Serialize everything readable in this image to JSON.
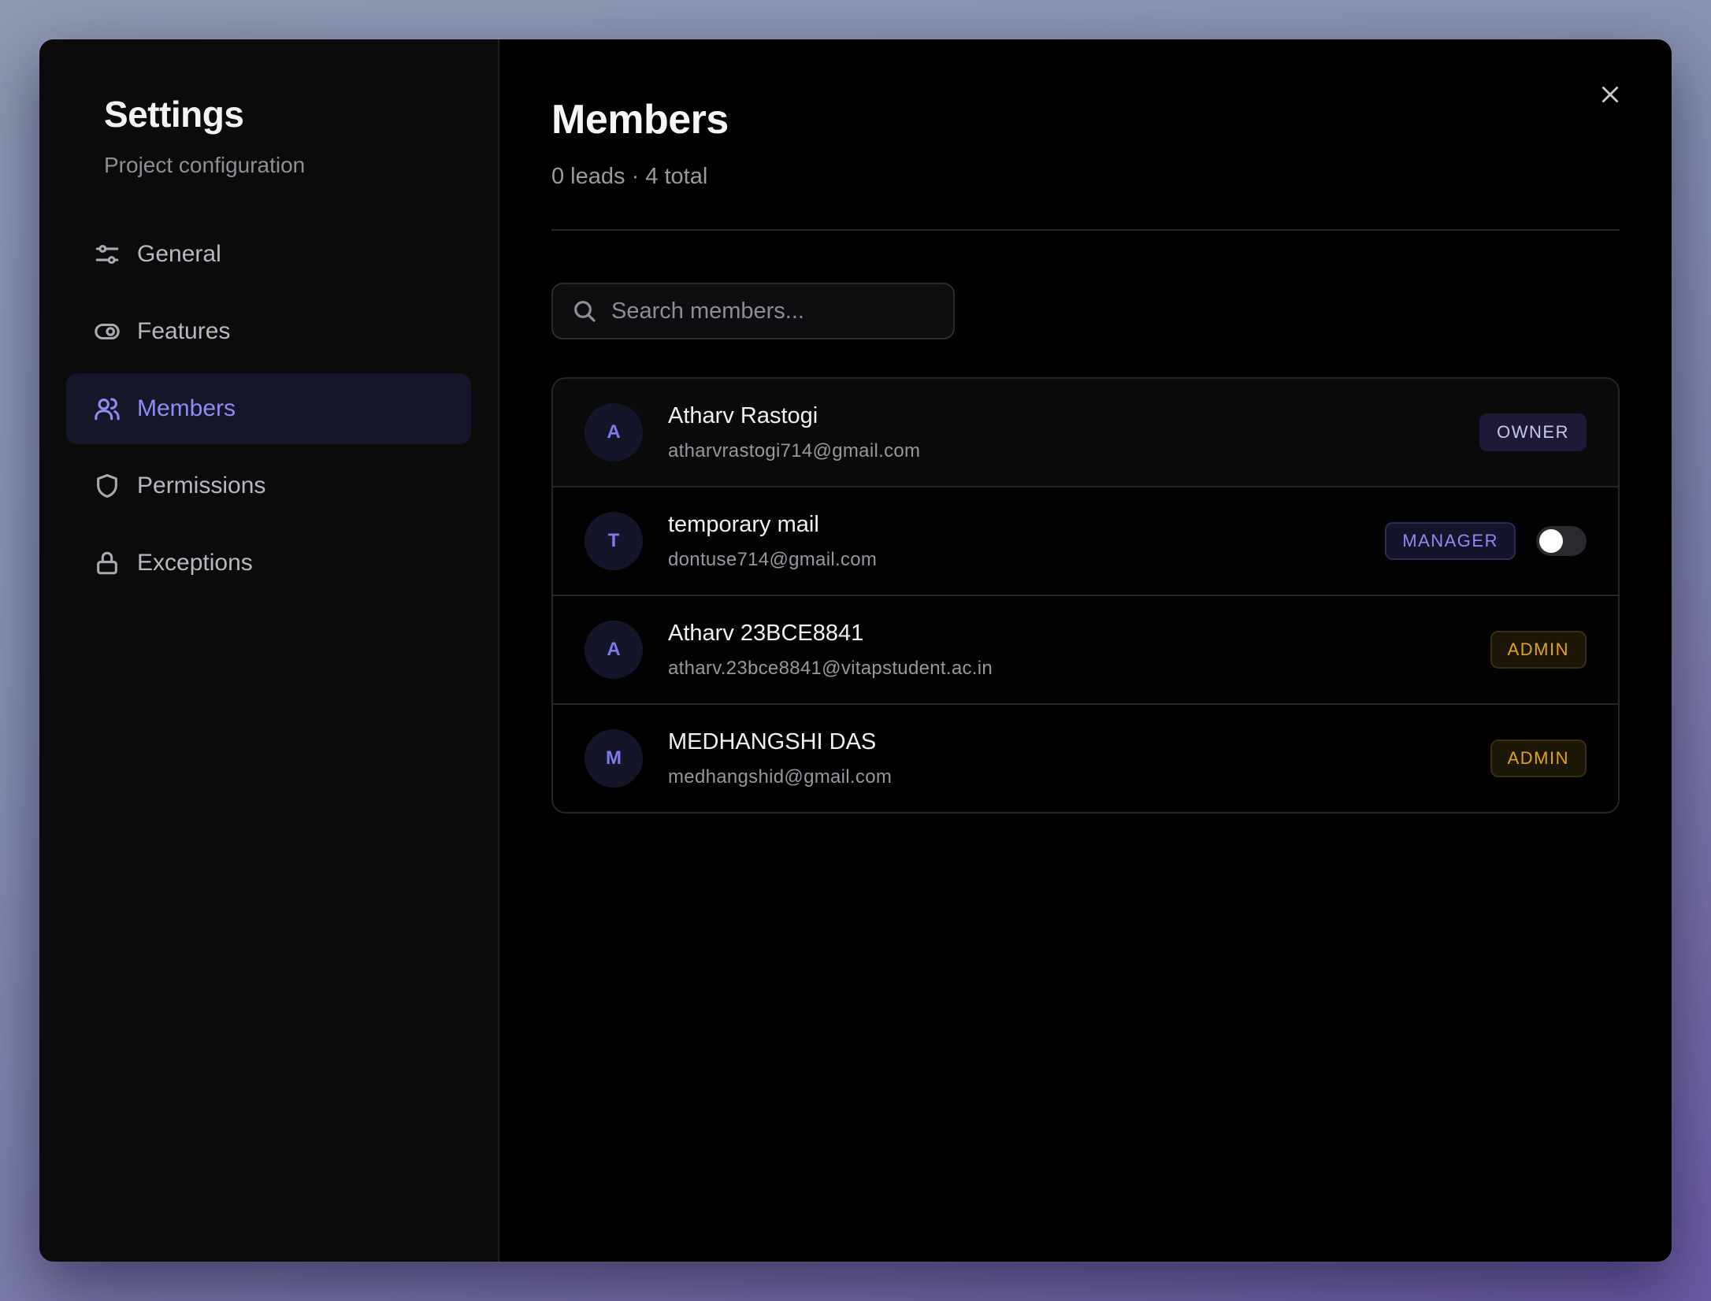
{
  "sidebar": {
    "title": "Settings",
    "subtitle": "Project configuration",
    "items": [
      {
        "label": "General",
        "icon": "sliders-icon",
        "active": false
      },
      {
        "label": "Features",
        "icon": "toggle-icon",
        "active": false
      },
      {
        "label": "Members",
        "icon": "users-icon",
        "active": true
      },
      {
        "label": "Permissions",
        "icon": "shield-icon",
        "active": false
      },
      {
        "label": "Exceptions",
        "icon": "lock-icon",
        "active": false
      }
    ]
  },
  "main": {
    "title": "Members",
    "subtitle": "0 leads · 4 total",
    "search": {
      "placeholder": "Search members...",
      "value": ""
    },
    "members": [
      {
        "initial": "A",
        "name": "Atharv Rastogi",
        "email": "atharvrastogi714@gmail.com",
        "role": "OWNER"
      },
      {
        "initial": "T",
        "name": "temporary mail",
        "email": "dontuse714@gmail.com",
        "role": "MANAGER",
        "toggle_on": false
      },
      {
        "initial": "A",
        "name": "Atharv 23BCE8841",
        "email": "atharv.23bce8841@vitapstudent.ac.in",
        "role": "ADMIN"
      },
      {
        "initial": "M",
        "name": "MEDHANGSHI DAS",
        "email": "medhangshid@gmail.com",
        "role": "ADMIN"
      }
    ]
  },
  "colors": {
    "accent": "#8e8cf2",
    "admin": "#e0a51e",
    "background": "#000000",
    "sidebar_bg": "#0b0b0c"
  }
}
